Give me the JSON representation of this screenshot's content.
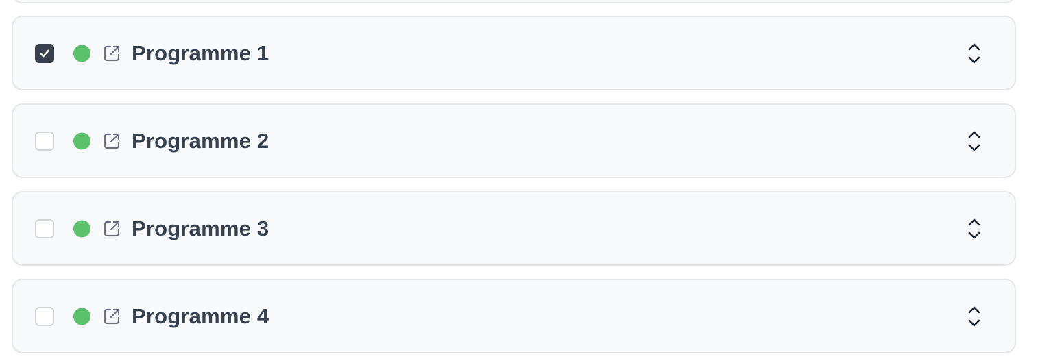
{
  "colors": {
    "status_active": "#5cc26a",
    "checkbox_checked": "#3a3f4d",
    "text": "#374151",
    "icon": "#6b7280"
  },
  "programmes": [
    {
      "label": "Programme 1",
      "checked": true,
      "status": "active"
    },
    {
      "label": "Programme 2",
      "checked": false,
      "status": "active"
    },
    {
      "label": "Programme 3",
      "checked": false,
      "status": "active"
    },
    {
      "label": "Programme 4",
      "checked": false,
      "status": "active"
    }
  ],
  "icons": {
    "check": "check-icon",
    "status": "status-dot",
    "external": "external-link-icon",
    "expand": "chevron-up-down-icon"
  }
}
